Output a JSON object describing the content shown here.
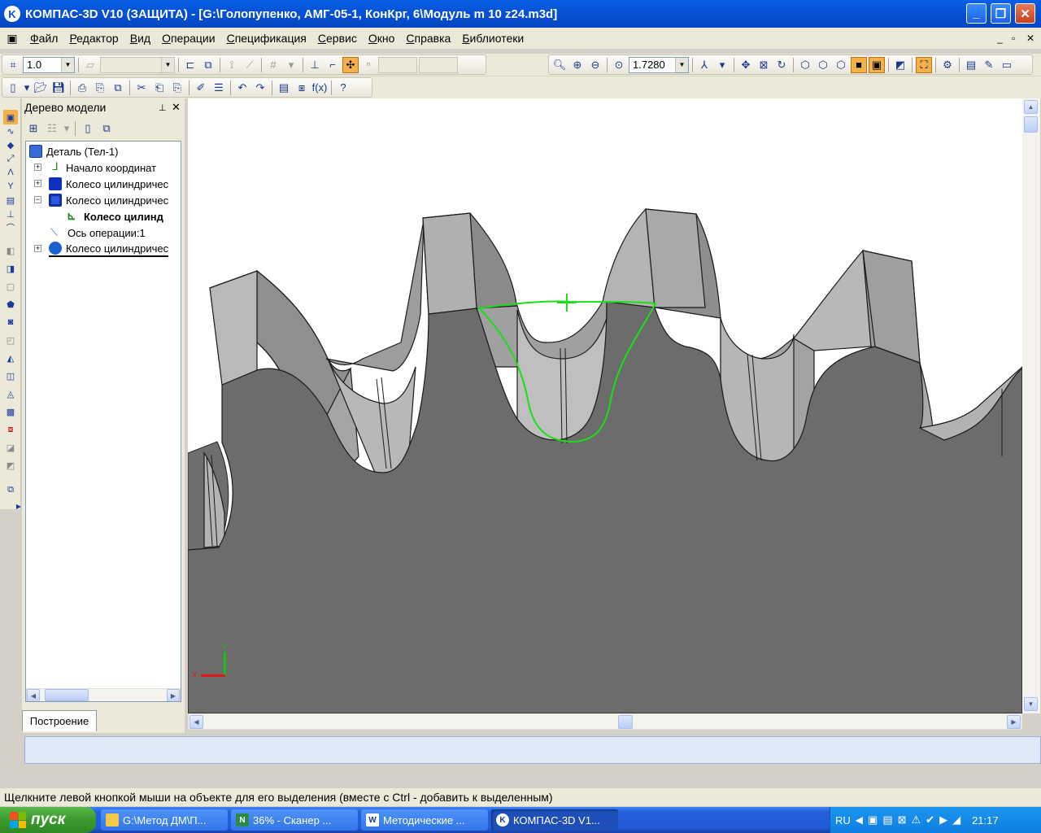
{
  "window": {
    "title": "КОМПАС-3D V10 (ЗАЩИТА) - [G:\\Голопупенко, АМГ-05-1, КонКрг, 6\\Модуль m 10 z24.m3d]",
    "app_icon": "kompas-icon"
  },
  "menu": [
    "Файл",
    "Редактор",
    "Вид",
    "Операции",
    "Спецификация",
    "Сервис",
    "Окно",
    "Справка",
    "Библиотеки"
  ],
  "toolbar": {
    "step_value": "1.0",
    "zoom_value": "1.7280"
  },
  "tree": {
    "header": "Дерево модели",
    "nodes": [
      {
        "label": "Деталь (Тел-1)",
        "icon": "part-icon"
      },
      {
        "label": "Начало координат",
        "icon": "origin-icon"
      },
      {
        "label": "Колесо цилиндричес",
        "icon": "extrude-icon"
      },
      {
        "label": "Колесо цилиндричес",
        "icon": "cut-icon"
      },
      {
        "label": "Колесо цилинд",
        "icon": "sketch-icon"
      },
      {
        "label": "Ось операции:1",
        "icon": "axis-icon"
      },
      {
        "label": "Колесо цилиндричес",
        "icon": "array-icon"
      }
    ],
    "tab_label": "Построение"
  },
  "axes": {
    "x": "X",
    "y": "Y"
  },
  "status_text": "Щелкните левой кнопкой мыши на объекте для его выделения (вместе с Ctrl - добавить к выделенным)",
  "taskbar": {
    "start_label": "пуск",
    "items": [
      {
        "label": "G:\\Метод ДМ\\П...",
        "icon": "folder-icon"
      },
      {
        "label": "36% - Сканер ...",
        "icon": "scanner-icon"
      },
      {
        "label": "Методические ...",
        "icon": "word-icon"
      },
      {
        "label": "КОМПАС-3D V1...",
        "icon": "kompas-icon"
      }
    ],
    "lang": "RU",
    "clock": "21:17"
  }
}
